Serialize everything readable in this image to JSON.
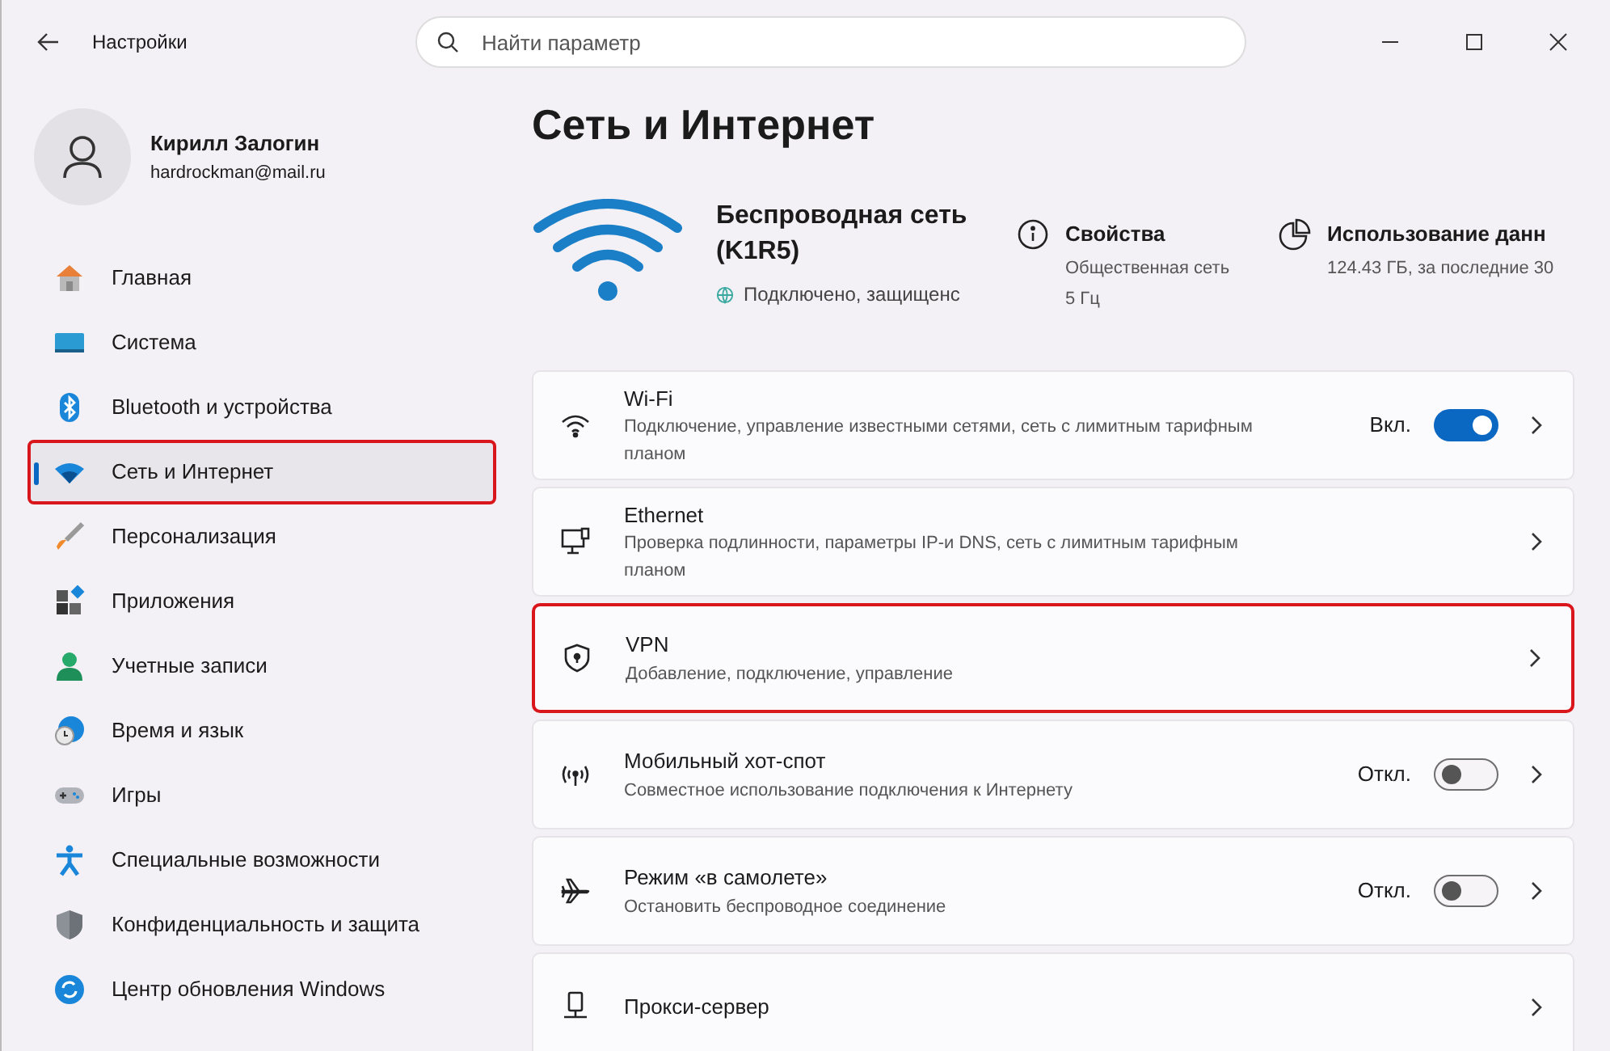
{
  "window": {
    "title": "Настройки"
  },
  "search": {
    "placeholder": "Найти параметр"
  },
  "user": {
    "name": "Кирилл Залогин",
    "email": "hardrockman@mail.ru"
  },
  "sidebar": {
    "items": [
      {
        "label": "Главная",
        "selected": false,
        "highlighted": false
      },
      {
        "label": "Система",
        "selected": false,
        "highlighted": false
      },
      {
        "label": "Bluetooth и устройства",
        "selected": false,
        "highlighted": false
      },
      {
        "label": "Сеть и Интернет",
        "selected": true,
        "highlighted": true
      },
      {
        "label": "Персонализация",
        "selected": false,
        "highlighted": false
      },
      {
        "label": "Приложения",
        "selected": false,
        "highlighted": false
      },
      {
        "label": "Учетные записи",
        "selected": false,
        "highlighted": false
      },
      {
        "label": "Время и язык",
        "selected": false,
        "highlighted": false
      },
      {
        "label": "Игры",
        "selected": false,
        "highlighted": false
      },
      {
        "label": "Специальные возможности",
        "selected": false,
        "highlighted": false
      },
      {
        "label": "Конфиденциальность и защита",
        "selected": false,
        "highlighted": false
      },
      {
        "label": "Центр обновления Windows",
        "selected": false,
        "highlighted": false
      }
    ]
  },
  "page": {
    "title": "Сеть и Интернет"
  },
  "connection": {
    "name": "Беспроводная сеть (K1R5)",
    "status": "Подключено, защищенс",
    "properties": {
      "title": "Свойства",
      "lines": [
        "Общественная сеть",
        "5 Гц"
      ]
    },
    "usage": {
      "title": "Использование данн",
      "lines": [
        "124.43 ГБ, за последние 30"
      ]
    }
  },
  "settings": [
    {
      "kind": "toggle",
      "title": "Wi-Fi",
      "description": "Подключение, управление известными сетями, сеть с лимитным тарифным планом",
      "on": true,
      "state_label": "Вкл.",
      "highlighted": false
    },
    {
      "kind": "link",
      "title": "Ethernet",
      "description": "Проверка подлинности, параметры IP-и DNS, сеть с лимитным тарифным планом",
      "highlighted": false
    },
    {
      "kind": "link",
      "title": "VPN",
      "description": "Добавление, подключение, управление",
      "highlighted": true
    },
    {
      "kind": "toggle",
      "title": "Мобильный хот-спот",
      "description": "Совместное использование подключения к Интернету",
      "on": false,
      "state_label": "Откл.",
      "highlighted": false
    },
    {
      "kind": "toggle",
      "title": "Режим «в самолете»",
      "description": "Остановить беспроводное соединение",
      "on": false,
      "state_label": "Откл.",
      "highlighted": false
    },
    {
      "kind": "link",
      "title": "Прокси-сервер",
      "highlighted": false
    }
  ]
}
